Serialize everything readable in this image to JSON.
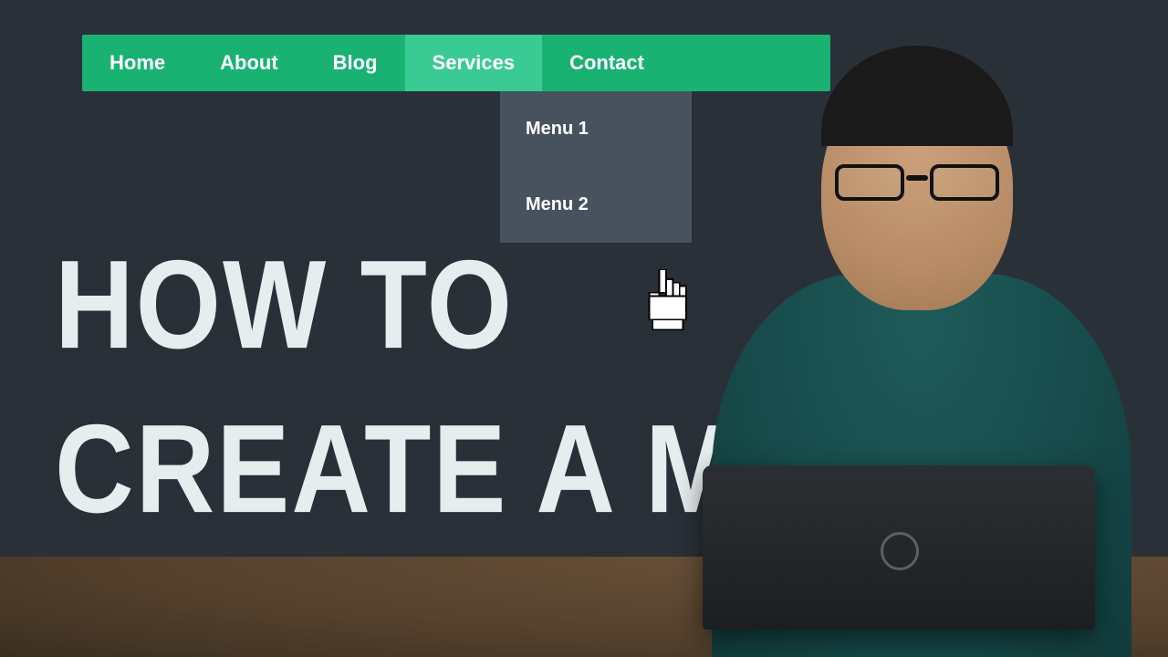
{
  "nav": {
    "items": [
      {
        "label": "Home",
        "active": false
      },
      {
        "label": "About",
        "active": false
      },
      {
        "label": "Blog",
        "active": false
      },
      {
        "label": "Services",
        "active": true
      },
      {
        "label": "Contact",
        "active": false
      }
    ]
  },
  "dropdown": {
    "items": [
      {
        "label": "Menu 1"
      },
      {
        "label": "Menu 2"
      }
    ]
  },
  "title": {
    "line1": "HOW TO",
    "line2": "CREATE A MENU"
  },
  "colors": {
    "background": "#2a3038",
    "nav_bg": "#19b273",
    "nav_active_bg": "#3acb94",
    "text_light": "#e7ecef"
  }
}
